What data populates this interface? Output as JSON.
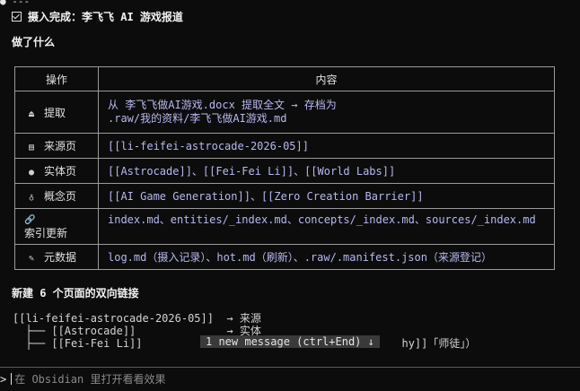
{
  "header": {
    "dashes": "---",
    "title": "摄入完成：李飞飞 AI 游戏报道",
    "section_title": "做了什么"
  },
  "table": {
    "col_action": "操作",
    "col_content": "内容",
    "rows": [
      {
        "icon": "inbox-icon",
        "action": "提取",
        "content": "从 李飞飞做AI游戏.docx 提取全文 → 存档为\n.raw/我的资料/李飞飞做AI游戏.md"
      },
      {
        "icon": "document-icon",
        "action": "来源页",
        "content": "[[li-feifei-astrocade-2026-05]]"
      },
      {
        "icon": "person-icon",
        "action": "实体页",
        "content": "[[Astrocade]]、[[Fei-Fei Li]]、[[World Labs]]"
      },
      {
        "icon": "lightbulb-icon",
        "action": "概念页",
        "content": "[[AI Game Generation]]、[[Zero Creation Barrier]]"
      },
      {
        "icon": "link-icon",
        "action": "索引更新",
        "content": "index.md、entities/_index.md、concepts/_index.md、sources/_index.md"
      },
      {
        "icon": "edit-document-icon",
        "action": "元数据",
        "content": "log.md（摄入记录）、hot.md（刷新）、.raw/.manifest.json（来源登记）"
      }
    ]
  },
  "links_section": {
    "title": "新建 6 个页面的双向链接",
    "tree": [
      "[[li-feifei-astrocade-2026-05]]  → 来源",
      "  ├── [[Astrocade]]              → 实体",
      "  ├── [[Fei-Fei Li]]                                        hy]]「师徒」）"
    ]
  },
  "toast": {
    "text": "1 new message (ctrl+End) ↓"
  },
  "prompt": {
    "symbol": ">",
    "placeholder": "在 Obsidian 里打开看看效果"
  }
}
